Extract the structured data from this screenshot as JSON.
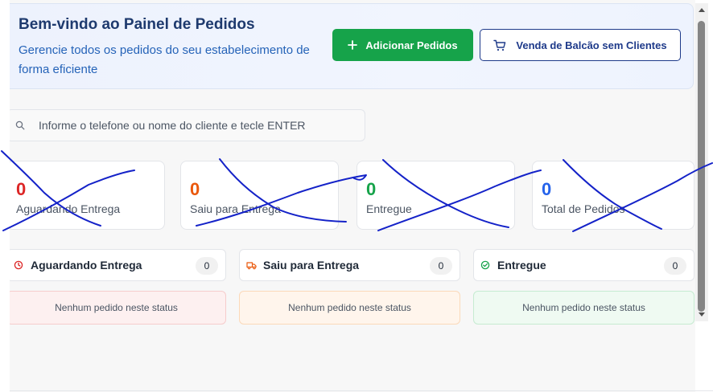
{
  "header": {
    "title": "Bem-vindo ao Painel de Pedidos",
    "subtitle": "Gerencie todos os pedidos do seu estabelecimento de forma eficiente",
    "add_button": "Adicionar Pedidos",
    "counter_button": "Venda de Balcão sem Clientes"
  },
  "search": {
    "placeholder": "Informe o telefone ou nome do cliente e tecle ENTER"
  },
  "stats": [
    {
      "value": "0",
      "label": "Aguardando Entrega",
      "color": "#dc2626"
    },
    {
      "value": "0",
      "label": "Saiu para Entrega",
      "color": "#ea580c"
    },
    {
      "value": "0",
      "label": "Entregue",
      "color": "#16a34a"
    },
    {
      "value": "0",
      "label": "Total de Pedidos",
      "color": "#2563eb"
    }
  ],
  "columns": [
    {
      "title": "Aguardando Entrega",
      "count": "0",
      "empty_text": "Nenhum pedido neste status",
      "icon": "clock-icon",
      "color": "#dc2626",
      "bg": "#fdf0f0",
      "border": "#f6cccc"
    },
    {
      "title": "Saiu para Entrega",
      "count": "0",
      "empty_text": "Nenhum pedido neste status",
      "icon": "truck-icon",
      "color": "#ea580c",
      "bg": "#fff5ec",
      "border": "#fbd9b9"
    },
    {
      "title": "Entregue",
      "count": "0",
      "empty_text": "Nenhum pedido neste status",
      "icon": "check-circle-icon",
      "color": "#16a34a",
      "bg": "#effaf2",
      "border": "#c6ebd1"
    }
  ],
  "colors": {
    "primary": "#1e3a8a",
    "success": "#16a34a",
    "scribble": "#1422c8"
  }
}
